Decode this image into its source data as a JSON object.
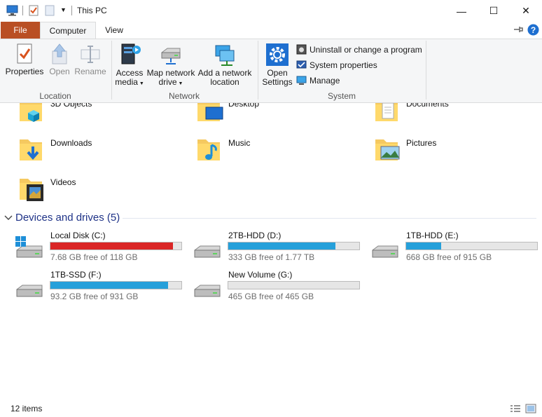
{
  "window": {
    "title": "This PC",
    "controls": {
      "minimize": "—",
      "maximize": "☐",
      "close": "✕"
    }
  },
  "tabs": {
    "file": "File",
    "computer": "Computer",
    "view": "View"
  },
  "ribbon": {
    "location": {
      "label": "Location",
      "properties": "Properties",
      "open": "Open",
      "rename": "Rename"
    },
    "network": {
      "label": "Network",
      "access_media_1": "Access",
      "access_media_2": "media",
      "map_drive_1": "Map network",
      "map_drive_2": "drive",
      "add_location_1": "Add a network",
      "add_location_2": "location"
    },
    "system": {
      "label": "System",
      "open_settings_1": "Open",
      "open_settings_2": "Settings",
      "uninstall": "Uninstall or change a program",
      "system_properties": "System properties",
      "manage": "Manage"
    }
  },
  "folders": [
    {
      "name": "3D Objects",
      "icon": "3d-objects-folder-icon"
    },
    {
      "name": "Desktop",
      "icon": "desktop-folder-icon"
    },
    {
      "name": "Documents",
      "icon": "documents-folder-icon"
    },
    {
      "name": "Downloads",
      "icon": "downloads-folder-icon"
    },
    {
      "name": "Music",
      "icon": "music-folder-icon"
    },
    {
      "name": "Pictures",
      "icon": "pictures-folder-icon"
    },
    {
      "name": "Videos",
      "icon": "videos-folder-icon"
    }
  ],
  "devices": {
    "header": "Devices and drives (5)",
    "drives": [
      {
        "name": "Local Disk (C:)",
        "free": "7.68 GB free of 118 GB",
        "used_fraction": 0.935,
        "bar_color": "#da2626",
        "icon": "windows-drive-icon"
      },
      {
        "name": "2TB-HDD (D:)",
        "free": "333 GB free of 1.77 TB",
        "used_fraction": 0.816,
        "bar_color": "#26a0da",
        "icon": "drive-icon"
      },
      {
        "name": "1TB-HDD (E:)",
        "free": "668 GB free of 915 GB",
        "used_fraction": 0.27,
        "bar_color": "#26a0da",
        "icon": "drive-icon"
      },
      {
        "name": "1TB-SSD (F:)",
        "free": "93.2 GB free of 931 GB",
        "used_fraction": 0.9,
        "bar_color": "#26a0da",
        "icon": "drive-icon"
      },
      {
        "name": "New Volume (G:)",
        "free": "465 GB free of 465 GB",
        "used_fraction": 0.0,
        "bar_color": "#26a0da",
        "icon": "drive-icon"
      }
    ]
  },
  "status": {
    "items": "12 items"
  }
}
